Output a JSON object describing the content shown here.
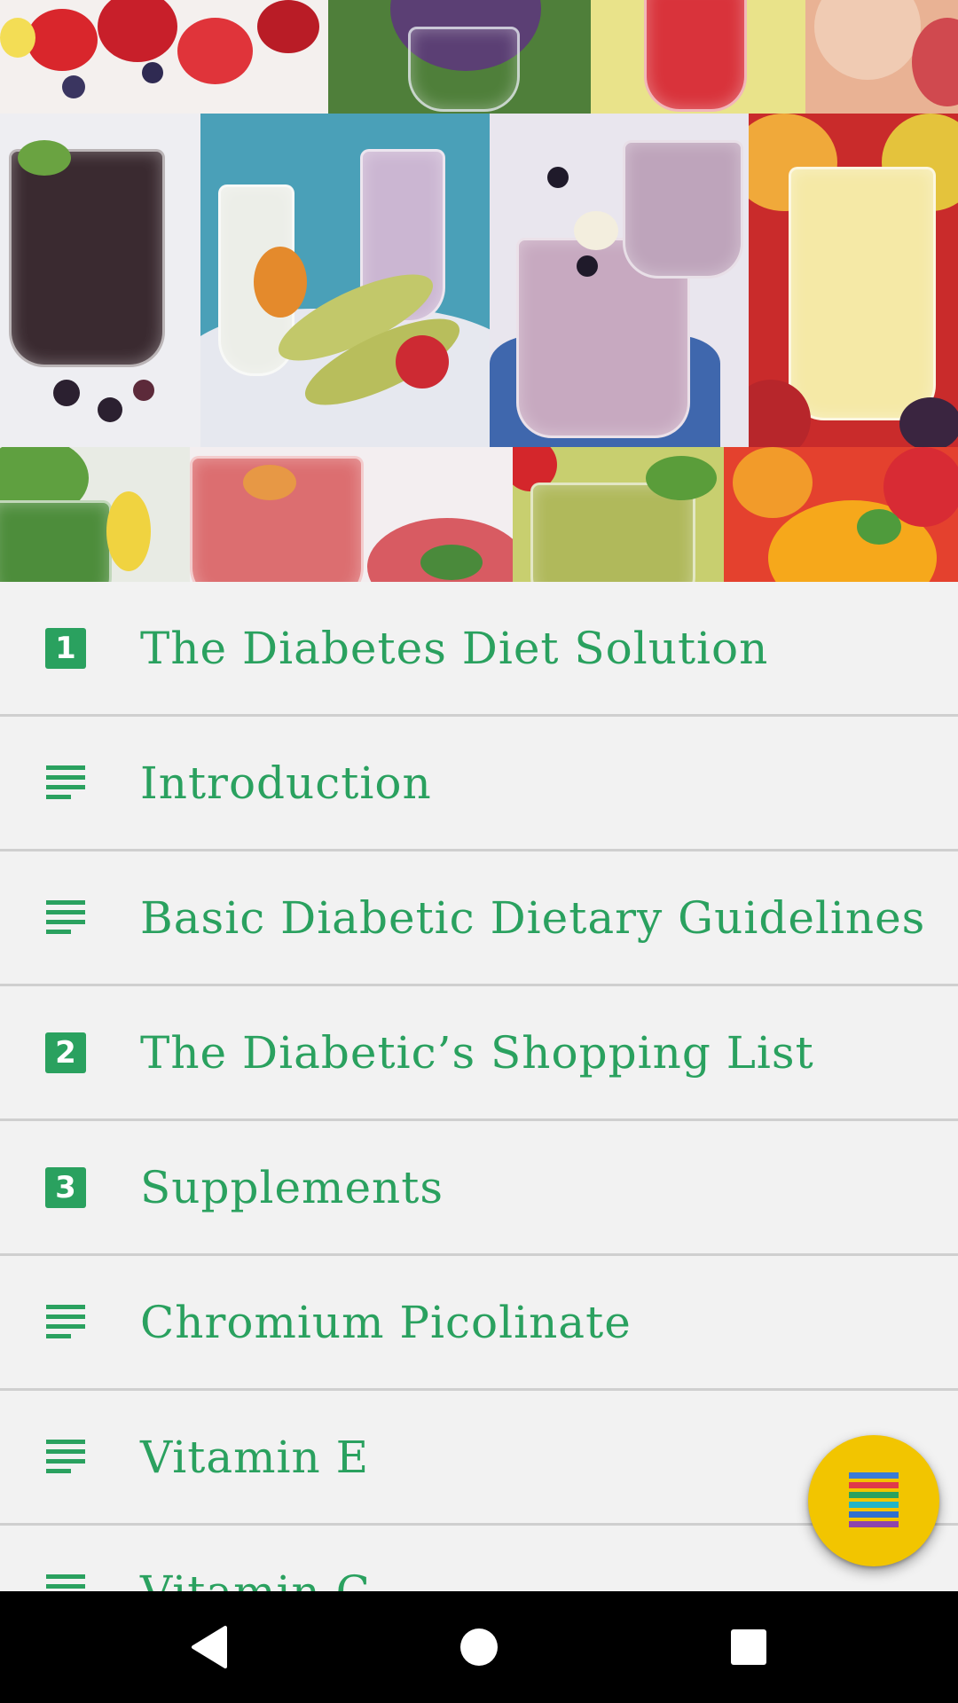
{
  "header": {
    "image_alt": "Smoothies and fruit collage"
  },
  "toc": {
    "items": [
      {
        "icon": "chapter-number-icon",
        "number": "1",
        "label": "The Diabetes Diet Solution"
      },
      {
        "icon": "text-lines-icon",
        "label": "Introduction"
      },
      {
        "icon": "text-lines-icon",
        "label": "Basic Diabetic Dietary Guidelines"
      },
      {
        "icon": "chapter-number-icon",
        "number": "2",
        "label": "The Diabetic’s Shopping List"
      },
      {
        "icon": "chapter-number-icon",
        "number": "3",
        "label": "Supplements"
      },
      {
        "icon": "text-lines-icon",
        "label": "Chromium Picolinate"
      },
      {
        "icon": "text-lines-icon",
        "label": "Vitamin E"
      },
      {
        "icon": "text-lines-icon",
        "label": "Vitamin C"
      }
    ]
  },
  "fab": {
    "icon": "colored-menu-icon"
  },
  "navbar": {
    "back_icon": "back-triangle-icon",
    "home_icon": "home-circle-icon",
    "recents_icon": "recents-square-icon"
  },
  "colors": {
    "accent_green": "#2aa15f",
    "list_background": "#f2f2f2",
    "divider": "#cfcfcf",
    "fab_yellow": "#f2c500",
    "navbar": "#000000"
  }
}
